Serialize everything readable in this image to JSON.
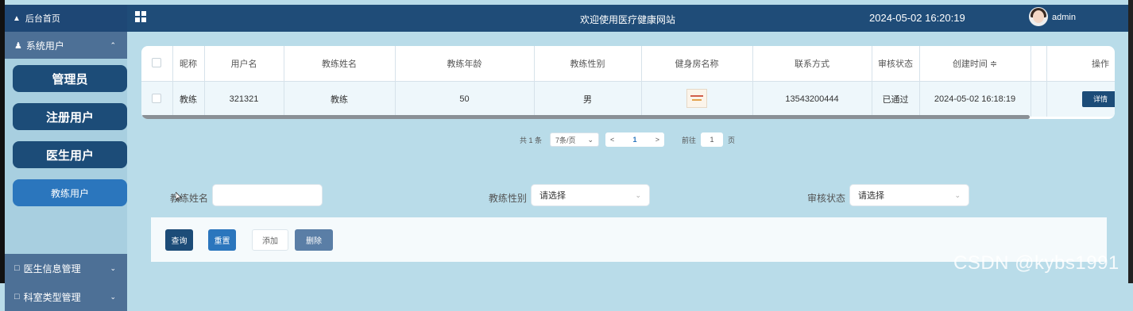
{
  "sidebar": {
    "home": "后台首页",
    "group": "系统用户",
    "submenu": [
      "管理员",
      "注册用户",
      "医生用户",
      "教练用户"
    ],
    "items": [
      "医生信息管理",
      "科室类型管理"
    ]
  },
  "header": {
    "title": "欢迎使用医疗健康网站",
    "datetime": "2024-05-02 16:20:19",
    "user": "admin"
  },
  "table": {
    "columns": [
      "昵称",
      "用户名",
      "教练姓名",
      "教练年龄",
      "教练性别",
      "健身房名称",
      "联系方式",
      "审核状态",
      "创建时间 ≑",
      "",
      "操作"
    ],
    "rows": [
      {
        "nickname": "教练",
        "username": "321321",
        "name": "教练",
        "age": "50",
        "gender": "男",
        "phone": "13543200444",
        "status": "已通过",
        "created": "2024-05-02 16:18:19",
        "action": "详情"
      }
    ]
  },
  "pagination": {
    "total": "共 1 条",
    "page_size": "7条/页",
    "prev": "<",
    "page": "1",
    "next": ">",
    "goto_label": "前往",
    "goto_value": "1",
    "unit": "页"
  },
  "search": {
    "name_label": "教练姓名",
    "name_value": "",
    "gender_label": "教练性别",
    "gender_placeholder": "请选择",
    "status_label": "审核状态",
    "status_placeholder": "请选择"
  },
  "actions": {
    "search": "查询",
    "reset": "重置",
    "add": "添加",
    "delete": "删除"
  },
  "watermark": "CSDN @kybs1991",
  "colors": {
    "primary": "#1c4c78",
    "accent": "#2b76bd",
    "background": "#b9dce9"
  }
}
